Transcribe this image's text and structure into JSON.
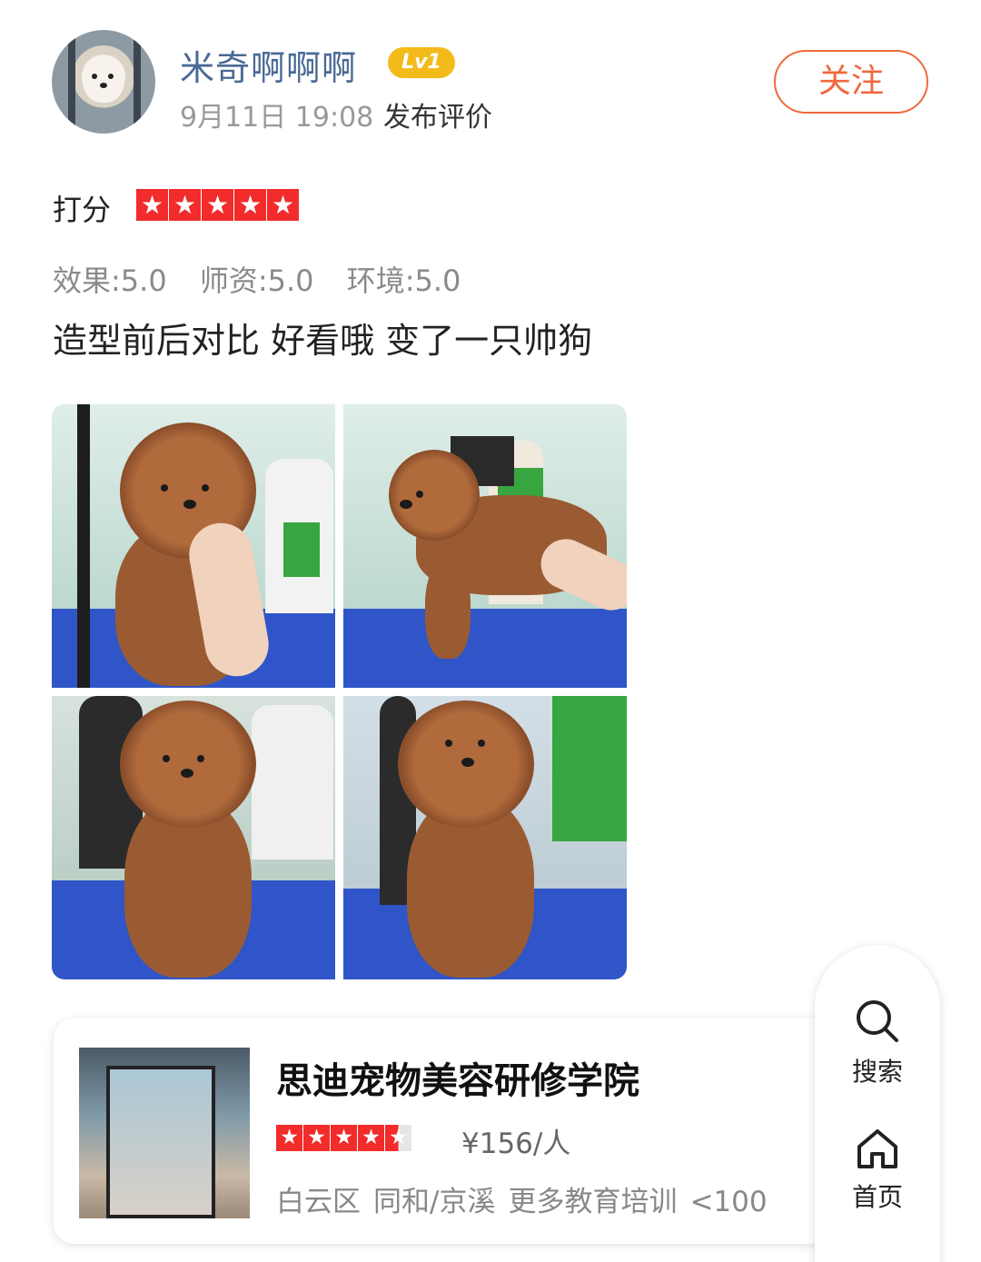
{
  "header": {
    "username": "米奇啊啊啊",
    "level": "Lv1",
    "time": "9月11日 19:08",
    "action": "发布评价",
    "follow_label": "关注"
  },
  "rating": {
    "label": "打分",
    "stars": 5,
    "sub_ratings": [
      "效果:5.0",
      "师资:5.0",
      "环境:5.0"
    ]
  },
  "comment": "造型前后对比 好看哦 变了一只帅狗",
  "photos": {
    "count": 4
  },
  "shop": {
    "name": "思迪宠物美容研修学院",
    "stars": 4.5,
    "price": "¥156/人",
    "district": "白云区",
    "area": "同和/京溪",
    "category": "更多教育培训",
    "distance": "<100"
  },
  "float_nav": {
    "search_label": "搜索",
    "home_label": "首页"
  },
  "colors": {
    "accent": "#f0683c",
    "username": "#4a6a94",
    "badge": "#f3bb1a",
    "star": "#f22b2b"
  }
}
